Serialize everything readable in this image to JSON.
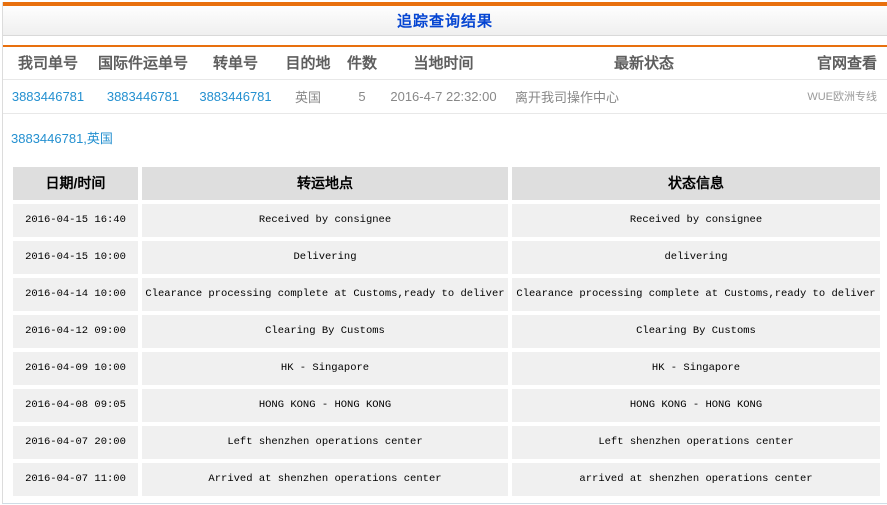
{
  "colors": {
    "accent_orange": "#e8700e",
    "title_blue": "#0545d2",
    "link_blue": "#2490d0"
  },
  "header": {
    "title": "追踪查询结果"
  },
  "summary_table": {
    "headers": [
      "我司单号",
      "国际件运单号",
      "转单号",
      "目的地",
      "件数",
      "当地时间",
      "最新状态",
      "官网查看"
    ],
    "row": {
      "our_no": "3883446781",
      "intl_no": "3883446781",
      "transfer_no": "3883446781",
      "destination": "英国",
      "pieces": "5",
      "local_time": "2016-4-7 22:32:00",
      "latest_status": "离开我司操作中心",
      "official_site": "WUE欧洲专线"
    }
  },
  "shipment_link": "3883446781,英国",
  "detail_table": {
    "headers": [
      "日期/时间",
      "转运地点",
      "状态信息"
    ],
    "rows": [
      [
        "2016-04-15 16:40",
        "Received by consignee",
        "Received by consignee"
      ],
      [
        "2016-04-15 10:00",
        "Delivering",
        "delivering"
      ],
      [
        "2016-04-14 10:00",
        "Clearance processing complete at Customs,ready to deliver",
        "Clearance processing complete at Customs,ready to deliver"
      ],
      [
        "2016-04-12 09:00",
        "Clearing By Customs",
        "Clearing By Customs"
      ],
      [
        "2016-04-09 10:00",
        "HK - Singapore",
        "HK - Singapore"
      ],
      [
        "2016-04-08 09:05",
        "HONG KONG - HONG KONG",
        "HONG KONG - HONG KONG"
      ],
      [
        "2016-04-07 20:00",
        "Left shenzhen operations center",
        "Left shenzhen operations center"
      ],
      [
        "2016-04-07 11:00",
        "Arrived at shenzhen operations center",
        "arrived at shenzhen operations center"
      ]
    ]
  }
}
